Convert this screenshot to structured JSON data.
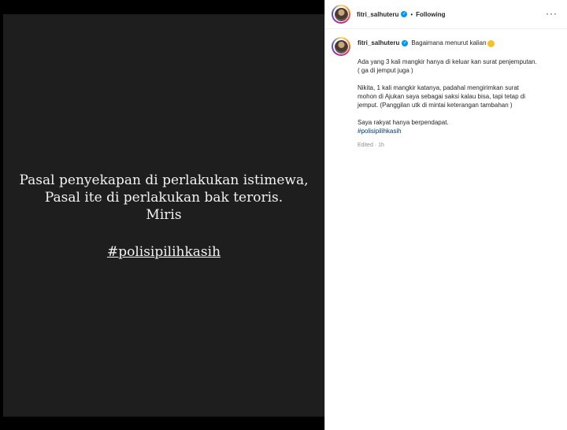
{
  "post": {
    "image_lines": [
      "Pasal penyekapan di perlakukan istimewa,",
      "Pasal ite di perlakukan bak teroris.",
      "Miris"
    ],
    "image_hashtag": "#polisipilihkasih"
  },
  "header": {
    "username": "fitri_salhuteru",
    "separator": "•",
    "follow_status": "Following"
  },
  "caption": {
    "username": "fitri_salhuteru",
    "first_line": "Bagaimana menurut kalian",
    "para1_line1": "Ada yang 3 kali mangkir hanya di keluar kan surat penjemputan.",
    "para1_line2": "( ga di jemput juga )",
    "para2_line1": "Nikita, 1 kali mangkir katanya, padahal mengirimkan surat",
    "para2_line2": "mohon di Ajukan saya sebagai saksi kalau bisa, tapi tetap di",
    "para2_line3": "jemput. (Panggilan utk di mintai keterangan tambahan )",
    "para3_line1": "Saya rakyat hanya berpendapat.",
    "hashtag": "#polisipilihkasih",
    "edited": "Edited · 1h"
  },
  "colors": {
    "media_bg": "#1e1e1e",
    "verified": "#0095f6",
    "link": "#00376b"
  }
}
